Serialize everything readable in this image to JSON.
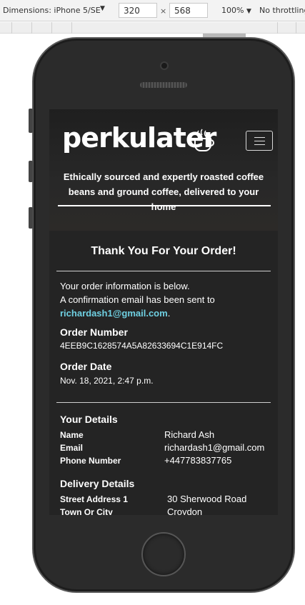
{
  "devtools": {
    "device": "Dimensions: iPhone 5/SE",
    "width": "320",
    "times": "×",
    "height": "568",
    "zoom": "100%",
    "throttle": "No throttling"
  },
  "header": {
    "logo": "perkulater",
    "tagline": "Ethically sourced and expertly roasted coffee beans and ground coffee, delivered to your home"
  },
  "confirmation": {
    "title": "Thank You For Your Order!",
    "intro_line1": "Your order information is below.",
    "intro_line2": "A confirmation email has been sent to",
    "email": "richardash1@gmail.com",
    "email_suffix": ".",
    "order_number_label": "Order Number",
    "order_number": "4EEB9C1628574A5A82633694C1E914FC",
    "order_date_label": "Order Date",
    "order_date": "Nov. 18, 2021, 2:47 p.m."
  },
  "your_details": {
    "heading": "Your Details",
    "rows": [
      {
        "label": "Name",
        "value": "Richard Ash"
      },
      {
        "label": "Email",
        "value": "richardash1@gmail.com"
      },
      {
        "label": "Phone Number",
        "value": "+447783837765"
      }
    ]
  },
  "delivery_details": {
    "heading": "Delivery Details",
    "rows": [
      {
        "label": "Street Address 1",
        "value": "30 Sherwood Road"
      },
      {
        "label": "Town Or City",
        "value": "Croydon"
      }
    ]
  }
}
